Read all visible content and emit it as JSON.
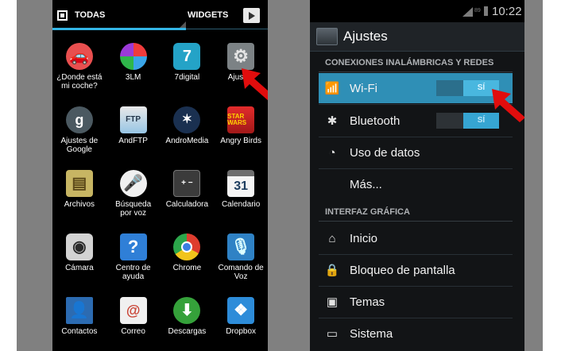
{
  "left_screen": {
    "tabs": {
      "all_label": "TODAS",
      "widgets_label": "WIDGETS"
    },
    "apps": [
      {
        "label": "¿Donde está\nmi coche?",
        "icon": "car-icon",
        "glyph": "🚗"
      },
      {
        "label": "3LM",
        "icon": "3lm-icon",
        "glyph": ""
      },
      {
        "label": "7digital",
        "icon": "7digital-icon",
        "glyph": "7"
      },
      {
        "label": "Ajustes",
        "icon": "settings-gear-icon",
        "glyph": "⚙"
      },
      {
        "label": "Ajustes de\nGoogle",
        "icon": "google-settings-icon",
        "glyph": "g"
      },
      {
        "label": "AndFTP",
        "icon": "ftp-icon",
        "glyph": "FTP"
      },
      {
        "label": "AndroMedia",
        "icon": "andromedia-icon",
        "glyph": "✶"
      },
      {
        "label": "Angry Birds",
        "icon": "angry-birds-icon",
        "glyph": "STAR WARS"
      },
      {
        "label": "Archivos",
        "icon": "files-icon",
        "glyph": "▤"
      },
      {
        "label": "Búsqueda\npor voz",
        "icon": "voice-search-icon",
        "glyph": "🎤"
      },
      {
        "label": "Calculadora",
        "icon": "calculator-icon",
        "glyph": "+ −"
      },
      {
        "label": "Calendario",
        "icon": "calendar-icon",
        "glyph": "31"
      },
      {
        "label": "Cámara",
        "icon": "camera-icon",
        "glyph": "◉"
      },
      {
        "label": "Centro de\nayuda",
        "icon": "help-icon",
        "glyph": "?"
      },
      {
        "label": "Chrome",
        "icon": "chrome-icon",
        "glyph": ""
      },
      {
        "label": "Comando de\nVoz",
        "icon": "voice-command-icon",
        "glyph": "🎙"
      },
      {
        "label": "Contactos",
        "icon": "contacts-icon",
        "glyph": "👤"
      },
      {
        "label": "Correo",
        "icon": "mail-icon",
        "glyph": "@"
      },
      {
        "label": "Descargas",
        "icon": "downloads-icon",
        "glyph": "⬇"
      },
      {
        "label": "Dropbox",
        "icon": "dropbox-icon",
        "glyph": "❖"
      }
    ]
  },
  "right_screen": {
    "status": {
      "time": "10:22",
      "battery": "89"
    },
    "action_bar": {
      "title": "Ajustes"
    },
    "sections": [
      {
        "header": "CONEXIONES INALÁMBRICAS Y REDES"
      },
      {
        "header": "INTERFAZ GRÁFICA"
      }
    ],
    "rows": [
      {
        "label": "Wi-Fi",
        "icon": "wifi-icon",
        "glyph": "📶",
        "switch": "SÍ"
      },
      {
        "label": "Bluetooth",
        "icon": "bluetooth-icon",
        "glyph": "✱",
        "switch": "SÍ"
      },
      {
        "label": "Uso de datos",
        "icon": "data-usage-icon",
        "glyph": "◔"
      },
      {
        "label": "Más...",
        "icon": "",
        "glyph": ""
      },
      {
        "label": "Inicio",
        "icon": "home-icon",
        "glyph": "⌂"
      },
      {
        "label": "Bloqueo de pantalla",
        "icon": "lock-icon",
        "glyph": "🔒"
      },
      {
        "label": "Temas",
        "icon": "themes-icon",
        "glyph": "▣"
      },
      {
        "label": "Sistema",
        "icon": "system-icon",
        "glyph": "▭"
      }
    ]
  },
  "colors": {
    "accent": "#33b5e5",
    "highlight": "#2f8fb6",
    "arrow": "#e10d0d"
  }
}
